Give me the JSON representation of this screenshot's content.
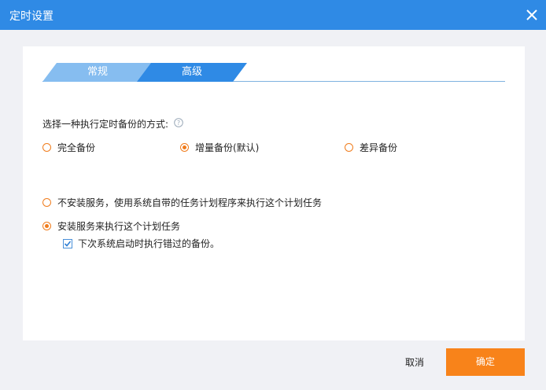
{
  "window": {
    "title": "定时设置"
  },
  "tabs": [
    {
      "label": "常规",
      "active": false
    },
    {
      "label": "高级",
      "active": true
    }
  ],
  "backup_mode": {
    "label": "选择一种执行定时备份的方式:",
    "options": [
      {
        "label": "完全备份",
        "checked": false
      },
      {
        "label": "增量备份(默认)",
        "checked": true
      },
      {
        "label": "差异备份",
        "checked": false
      }
    ]
  },
  "service_mode": {
    "options": [
      {
        "label": "不安装服务，使用系统自带的任务计划程序来执行这个计划任务",
        "checked": false
      },
      {
        "label": "安装服务来执行这个计划任务",
        "checked": true
      }
    ],
    "missed_backup": {
      "label": "下次系统启动时执行错过的备份。",
      "checked": true
    }
  },
  "buttons": {
    "cancel": "取消",
    "ok": "确定"
  },
  "colors": {
    "titlebar": "#2f8ae5",
    "accent": "#f8831a",
    "tab_active": "#2f8ae5",
    "tab_inactive": "#86bdf0"
  }
}
